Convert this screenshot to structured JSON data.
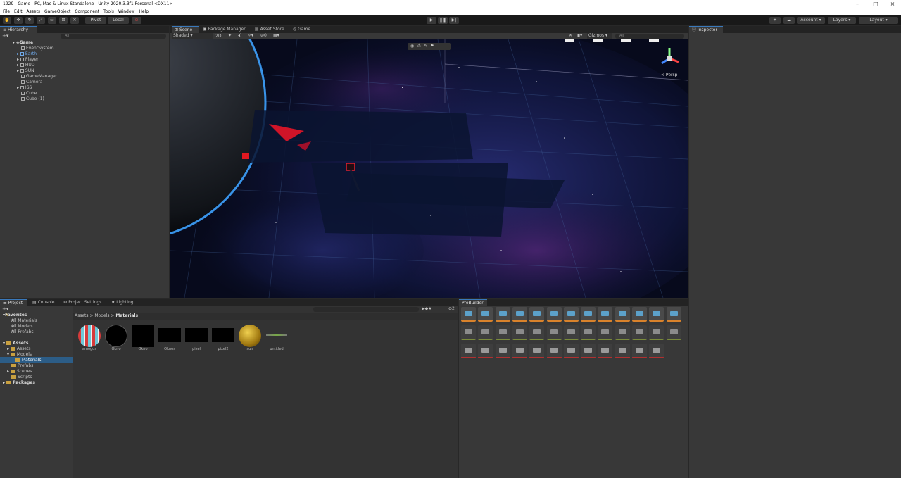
{
  "window": {
    "title": "1929 - Game - PC, Mac & Linux Standalone - Unity 2020.3.3f1 Personal <DX11>"
  },
  "menu": [
    "File",
    "Edit",
    "Assets",
    "GameObject",
    "Component",
    "Tools",
    "Window",
    "Help"
  ],
  "toolbar": {
    "pivot": "Pivot",
    "local": "Local",
    "account": "Account",
    "layers": "Layers",
    "layout": "Layout"
  },
  "hierarchy": {
    "tab": "Hierarchy",
    "search": "All",
    "scene": "Game",
    "items": [
      "EventSystem",
      "Earth",
      "Player",
      "HUD",
      "SUN",
      "GameManager",
      "Camera",
      "ISS",
      "Cube",
      "Cube (1)"
    ]
  },
  "scene_tabs": {
    "scene": "Scene",
    "package": "Package Manager",
    "store": "Asset Store",
    "game": "Game"
  },
  "scene_toolbar": {
    "shading": "Shaded",
    "mode2d": "2D",
    "gizmos": "Gizmos",
    "search": "All",
    "persp": "< Persp"
  },
  "inspector": {
    "tab": "Inspector"
  },
  "project_tabs": {
    "project": "Project",
    "console": "Console",
    "settings": "Project Settings",
    "lighting": "Lighting"
  },
  "project_tree": {
    "favorites": "Favorites",
    "fav_items": [
      "All Materials",
      "All Models",
      "All Prefabs"
    ],
    "assets": "Assets",
    "asset_items": [
      "Assets",
      "Models",
      "Materials",
      "Prefabs",
      "Scenes",
      "Scripts"
    ],
    "packages": "Packages"
  },
  "breadcrumb": {
    "a": "Assets",
    "b": "Models",
    "c": "Materials"
  },
  "materials": [
    "amogus",
    "Okno",
    "Okno",
    "Oknos",
    "pixel",
    "pixel2",
    "sun",
    "untitled"
  ],
  "hidden_count": "2",
  "probuilder": {
    "tab": "ProBuilder"
  }
}
